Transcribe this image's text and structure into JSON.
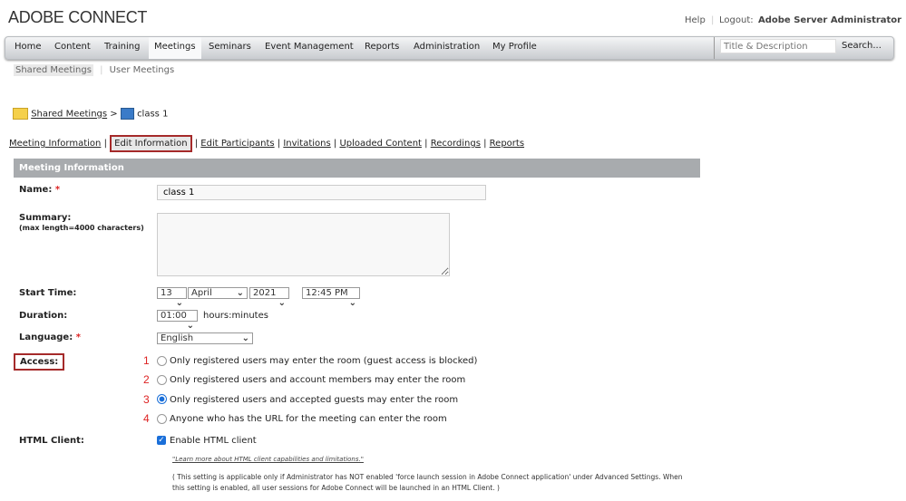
{
  "app": {
    "logo": "ADOBE CONNECT"
  },
  "header": {
    "help": "Help",
    "logout_label": "Logout:",
    "user": "Adobe Server Administrator"
  },
  "nav": {
    "items": [
      "Home",
      "Content",
      "Training",
      "Meetings",
      "Seminars",
      "Event Management",
      "Reports",
      "Administration",
      "My Profile"
    ],
    "active": "Meetings",
    "search_placeholder": "Title & Description",
    "search_button": "Search..."
  },
  "subnav": {
    "items": [
      "Shared Meetings",
      "User Meetings"
    ]
  },
  "breadcrumb": {
    "parent": "Shared Meetings",
    "sep": ">",
    "current": "class 1"
  },
  "tabs": [
    "Meeting Information",
    "Edit Information",
    "Edit Participants",
    "Invitations",
    "Uploaded Content",
    "Recordings",
    "Reports"
  ],
  "form": {
    "section_title": "Meeting Information",
    "name_label": "Name:",
    "name_value": "class 1",
    "required": "*",
    "summary_label": "Summary:",
    "summary_hint": "(max length=4000 characters)",
    "summary_value": "",
    "start_label": "Start Time:",
    "day": "13",
    "month": "April",
    "year": "2021",
    "time": "12:45 PM",
    "duration_label": "Duration:",
    "duration": "01:00",
    "duration_unit": "hours:minutes",
    "language_label": "Language:",
    "language": "English",
    "access_label": "Access:",
    "access_options": [
      {
        "num": "1",
        "label": "Only registered users may enter the room (guest access is blocked)",
        "selected": false
      },
      {
        "num": "2",
        "label": "Only registered users and account members may enter the room",
        "selected": false
      },
      {
        "num": "3",
        "label": "Only registered users and accepted guests may enter the room",
        "selected": true
      },
      {
        "num": "4",
        "label": "Anyone who has the URL for the meeting can enter the room",
        "selected": false
      }
    ],
    "html_label": "HTML Client:",
    "html_checkbox": "Enable HTML client",
    "html_checked": true,
    "learn_more": "\"Learn more about HTML client capabilities and limitations.\"",
    "note1": "( This setting is applicable only if Administrator has NOT enabled 'force launch session in Adobe Connect application' under Advanced Settings. When",
    "note2": "this setting is enabled, all user sessions for Adobe Connect will be launched in an HTML Client. )"
  },
  "colors": {
    "accent_red": "#a52a2a",
    "header_gray": "#a8abae",
    "radio_blue": "#1a6fd9"
  }
}
